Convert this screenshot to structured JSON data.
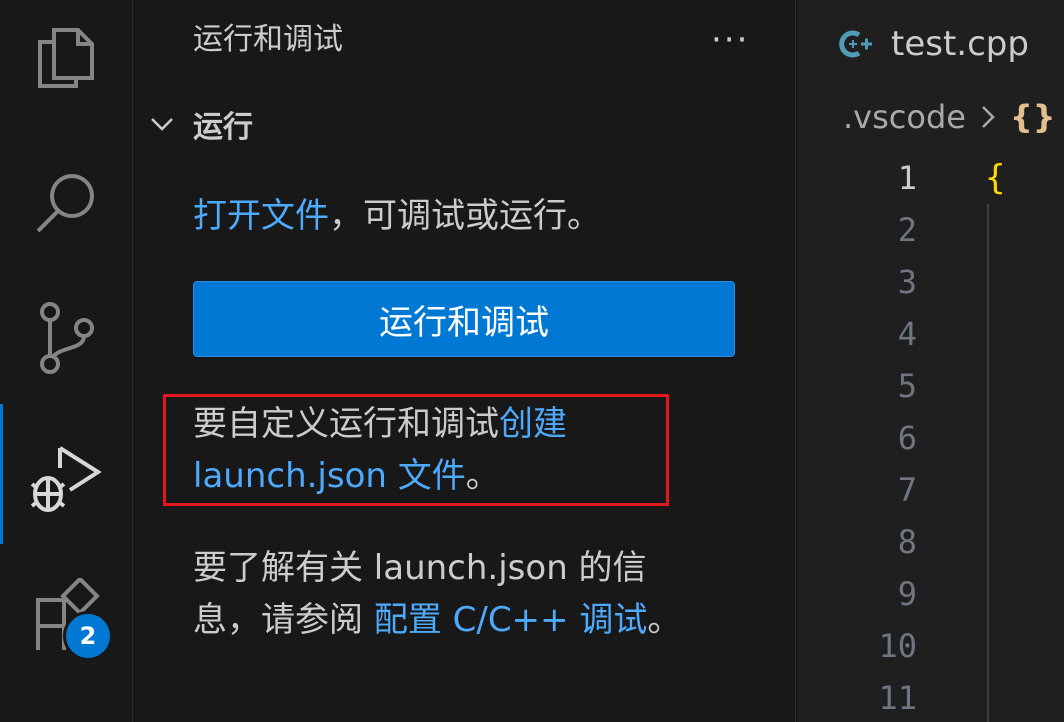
{
  "activity_bar": {
    "items": [
      {
        "icon": "files-icon"
      },
      {
        "icon": "search-icon"
      },
      {
        "icon": "source-control-icon"
      },
      {
        "icon": "run-debug-icon",
        "active": true
      },
      {
        "icon": "extensions-icon",
        "badge": "2"
      }
    ],
    "accent": "#0078d4"
  },
  "sidebar": {
    "title": "运行和调试",
    "more": "···",
    "section": {
      "label": "运行",
      "open_file_link": "打开文件",
      "open_file_rest": "，可调试或运行。",
      "run_button": "运行和调试",
      "customize_prefix": "要自定义运行和调试",
      "create_link_1": "创建",
      "create_link_2": "launch.json 文件",
      "create_suffix": "。",
      "learn_line1": "要了解有关 launch.json 的信",
      "learn_line2_prefix": "息，请参阅 ",
      "learn_link": "配置 C/C++ 调试",
      "learn_suffix": "。"
    }
  },
  "editor": {
    "tab": {
      "file_icon": "C++",
      "filename": "test.cpp"
    },
    "breadcrumb": {
      "folder": ".vscode",
      "json_symbol": "{}"
    },
    "line_numbers": [
      "1",
      "2",
      "3",
      "4",
      "5",
      "6",
      "7",
      "8",
      "9",
      "10",
      "11"
    ],
    "first_line_code": "{"
  },
  "colors": {
    "link": "#4daafc",
    "button": "#0078d4",
    "highlight_box": "#e0181e"
  }
}
